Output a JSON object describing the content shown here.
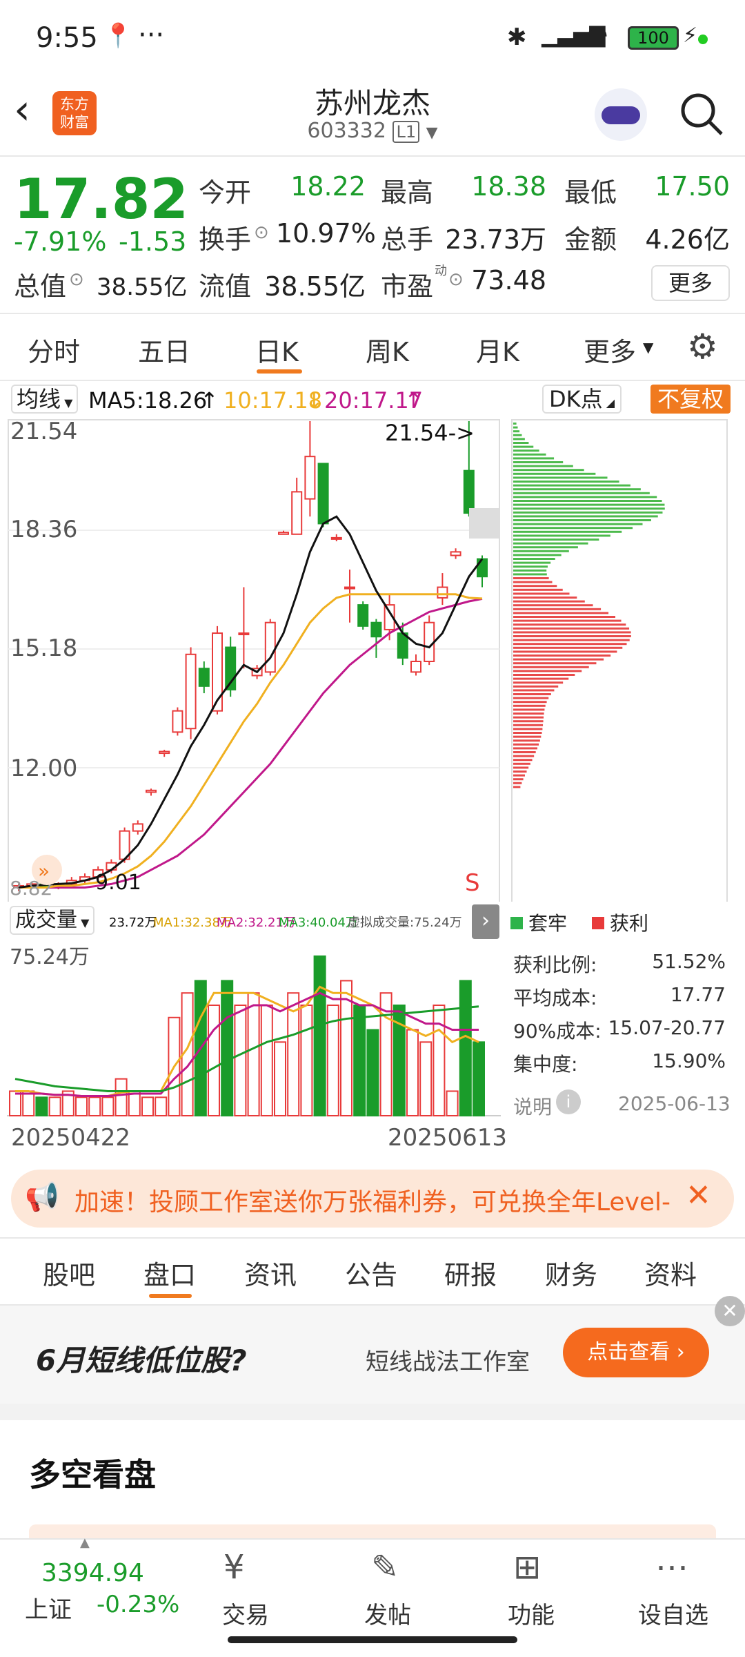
{
  "status_bar": {
    "time": "9:55",
    "battery": "100"
  },
  "header": {
    "title": "苏州龙杰",
    "code": "603332",
    "level": "L1",
    "logo_text_1": "东方",
    "logo_text_2": "财富"
  },
  "quote": {
    "price": "17.82",
    "change_pct": "-7.91%",
    "change": "-1.53",
    "open_label": "今开",
    "open": "18.22",
    "high_label": "最高",
    "high": "18.38",
    "low_label": "最低",
    "low": "17.50",
    "turnover_label": "换手",
    "turnover": "10.97%",
    "volume_label": "总手",
    "volume": "23.73万",
    "amount_label": "金额",
    "amount": "4.26亿",
    "total_mv_label": "总值",
    "total_mv": "38.55亿",
    "float_mv_label": "流值",
    "float_mv": "38.55亿",
    "pe_label": "市盈",
    "pe_sup": "动",
    "pe": "73.48",
    "more_label": "更多"
  },
  "period_tabs": [
    {
      "label": "分时"
    },
    {
      "label": "五日"
    },
    {
      "label": "日K",
      "active": true
    },
    {
      "label": "周K"
    },
    {
      "label": "月K"
    },
    {
      "label": "更多"
    }
  ],
  "ma_bar": {
    "select": "均线",
    "ma5": "MA5:18.26",
    "ma10": "10:17.18",
    "ma20": "20:17.17",
    "dk": "DK点",
    "fq": "不复权"
  },
  "price_chart": {
    "y_labels": [
      "21.54",
      "18.36",
      "15.18",
      "12.00"
    ],
    "high_annotation": "21.54->",
    "low_annotation": "9.01",
    "low_left": "8.82",
    "sell_marker": "S"
  },
  "volume_bar": {
    "select": "成交量",
    "vol": "23.72万",
    "ma1": "MA1:32.38万",
    "ma2": "MA2:32.21万",
    "ma3": "MA3:40.04万",
    "virtual": "虚拟成交量:75.24万",
    "max": "75.24万"
  },
  "dates": {
    "start": "20250422",
    "end": "20250613"
  },
  "chip": {
    "legend_trapped": "套牢",
    "legend_profit": "获利",
    "rows": [
      {
        "label": "获利比例:",
        "value": "51.52%"
      },
      {
        "label": "平均成本:",
        "value": "17.77"
      },
      {
        "label": "90%成本:",
        "value": "15.07-20.77"
      },
      {
        "label": "集中度:",
        "value": "15.90%"
      }
    ],
    "note_label": "说明",
    "date": "2025-06-13"
  },
  "banner": {
    "text": "加速！投顾工作室送你万张福利券，可兑换全年Level-"
  },
  "info_tabs": [
    {
      "label": "股吧"
    },
    {
      "label": "盘口",
      "active": true
    },
    {
      "label": "资讯"
    },
    {
      "label": "公告"
    },
    {
      "label": "研报"
    },
    {
      "label": "财务"
    },
    {
      "label": "资料"
    }
  ],
  "ad": {
    "title": "6月短线低位股?",
    "subtitle": "短线战法工作室",
    "button": "点击查看 ›"
  },
  "section_title": "多空看盘",
  "bottom_bar": {
    "index_value": "3394.94",
    "index_name": "上证",
    "index_change": "-0.23%",
    "items": [
      {
        "label": "交易"
      },
      {
        "label": "发帖"
      },
      {
        "label": "功能"
      },
      {
        "label": "设自选"
      }
    ]
  },
  "colors": {
    "up": "#e83a3a",
    "down": "#1a9c2a",
    "ma5": "#111111",
    "ma10": "#f0b020",
    "ma20": "#c0188a",
    "accent": "#f07a1f"
  }
}
